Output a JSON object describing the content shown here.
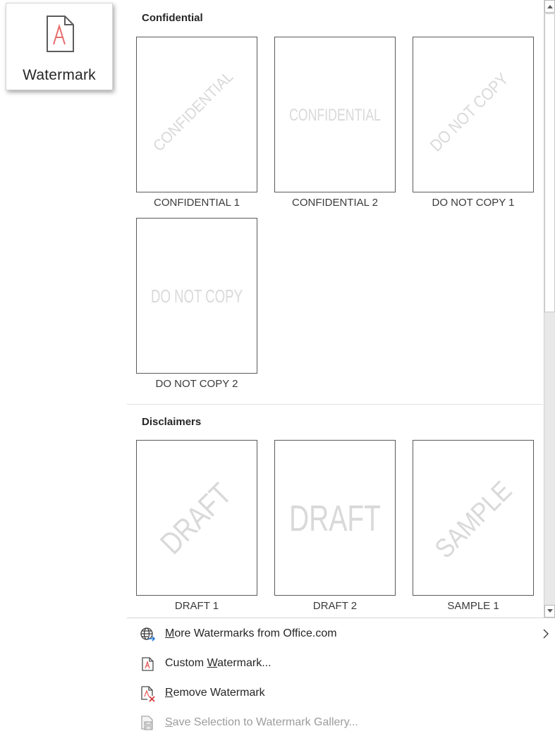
{
  "ribbon": {
    "watermark_label": "Watermark",
    "icon": "watermark-page-icon"
  },
  "gallery": {
    "sections": [
      {
        "header": "Confidential",
        "items": [
          {
            "label": "CONFIDENTIAL 1",
            "text": "CONFIDENTIAL",
            "style": "diagonal"
          },
          {
            "label": "CONFIDENTIAL 2",
            "text": "CONFIDENTIAL",
            "style": "horizontal"
          },
          {
            "label": "DO NOT COPY 1",
            "text": "DO NOT COPY",
            "style": "diagonal"
          },
          {
            "label": "DO NOT COPY 2",
            "text": "DO NOT COPY",
            "style": "horizontal"
          }
        ]
      },
      {
        "header": "Disclaimers",
        "items": [
          {
            "label": "DRAFT 1",
            "text": "DRAFT",
            "style": "diagonal"
          },
          {
            "label": "DRAFT 2",
            "text": "DRAFT",
            "style": "horizontal"
          },
          {
            "label": "SAMPLE 1",
            "text": "SAMPLE",
            "style": "diagonal"
          }
        ]
      }
    ]
  },
  "menu": {
    "more": {
      "prefix": "",
      "accel": "M",
      "rest": "ore Watermarks from Office.com",
      "icon": "globe-icon"
    },
    "custom": {
      "prefix": "Custom ",
      "accel": "W",
      "rest": "atermark...",
      "icon": "custom-watermark-icon"
    },
    "remove": {
      "prefix": "",
      "accel": "R",
      "rest": "emove Watermark",
      "icon": "remove-watermark-icon"
    },
    "save": {
      "prefix": "",
      "accel": "S",
      "rest": "ave Selection to Watermark Gallery...",
      "icon": "save-to-gallery-icon",
      "disabled": true
    }
  },
  "colors": {
    "watermark_text": "#d9d9d9",
    "accent_red": "#e35a5a",
    "accent_blue": "#2b7cd3"
  }
}
